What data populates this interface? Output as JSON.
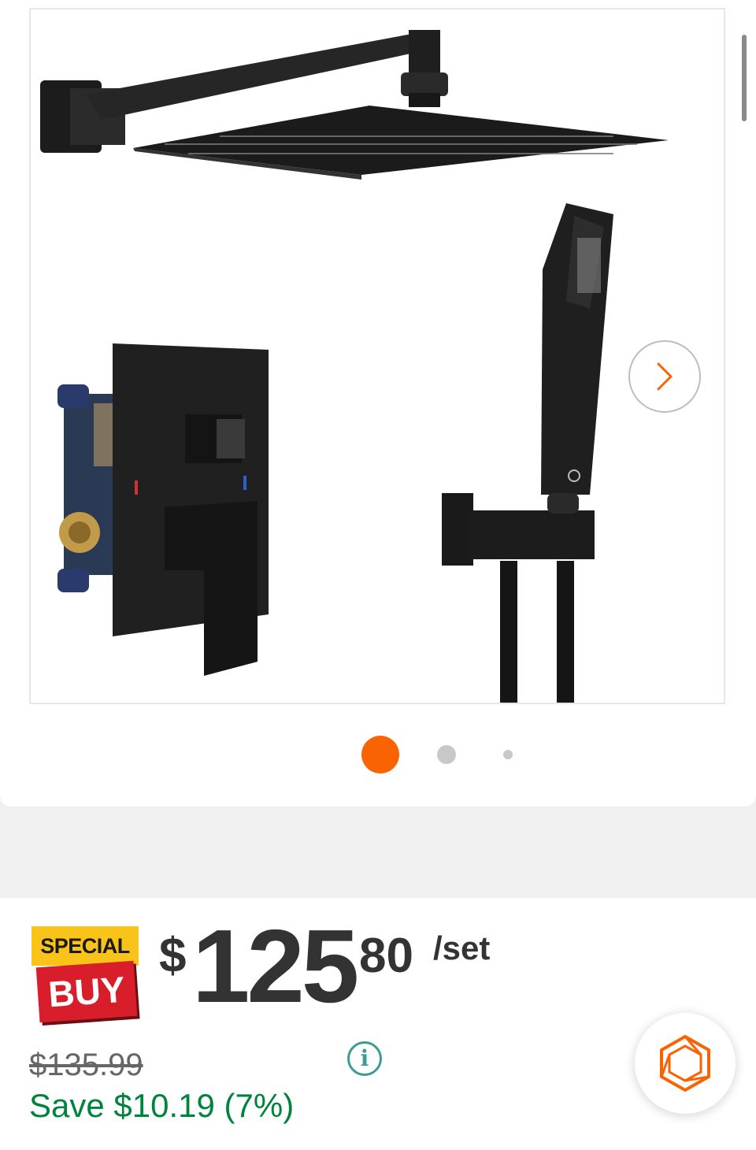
{
  "gallery": {
    "alt": "Matte black rain shower system with handheld shower and valve",
    "next_icon": "chevron-right-icon",
    "active_index": 1,
    "dot_count": 3
  },
  "price": {
    "badge_top": "SPECIAL",
    "badge_bottom": "BUY",
    "dollar_sign": "$",
    "whole": "125",
    "cents": "80",
    "unit": "/set",
    "was": "$135.99",
    "save": "Save $10.19 (7%)",
    "info_icon": "info-icon"
  },
  "floating_button": {
    "icon": "hexagon-chat-icon"
  },
  "colors": {
    "accent": "#f96302",
    "save_green": "#00843d",
    "badge_yellow": "#f9c31a",
    "badge_red": "#d81e2a",
    "info_teal": "#3e9b94"
  }
}
